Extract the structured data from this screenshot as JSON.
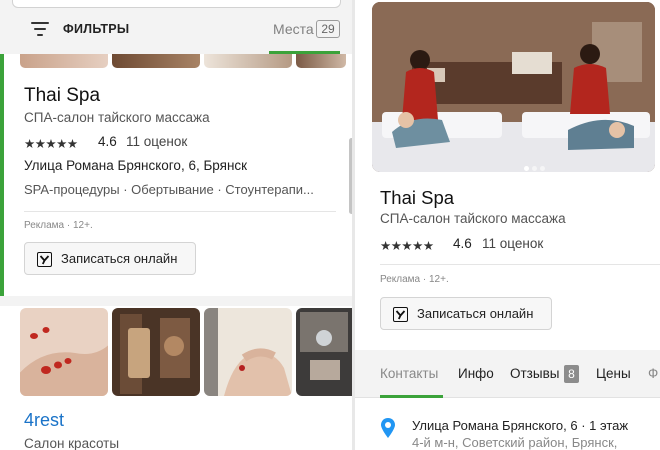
{
  "header": {
    "filters_label": "ФИЛЬТРЫ",
    "places_label": "Места",
    "places_count": "29"
  },
  "results": [
    {
      "title": "Thai Spa",
      "category": "СПА-салон тайского массажа",
      "stars": "★★★★★",
      "rating": "4.6",
      "reviews": "11 оценок",
      "address": "Улица Романа Брянского, 6, Брянск",
      "services": "SPA-процедуры · Обертывание · Стоунтерапи...",
      "ad_label": "Реклама · 12+.",
      "book_label": "Записаться онлайн"
    },
    {
      "title": "4rest",
      "category": "Салон красоты"
    }
  ],
  "detail": {
    "title": "Thai Spa",
    "category": "СПА-салон тайского массажа",
    "stars": "★★★★★",
    "rating": "4.6",
    "reviews": "11 оценок",
    "ad_label": "Реклама · 12+.",
    "book_label": "Записаться онлайн",
    "tabs": [
      {
        "label": "Контакты",
        "active": true
      },
      {
        "label": "Инфо"
      },
      {
        "label": "Отзывы",
        "badge": "8"
      },
      {
        "label": "Цены"
      },
      {
        "label": "Ф"
      }
    ],
    "address_line1": "Улица Романа Брянского, 6 · 1 этаж",
    "address_line2": "4-й м-н, Советский район, Брянск,"
  },
  "colors": {
    "accent_green": "#3ba33a",
    "link_blue": "#1a73c8",
    "pin_blue": "#2196f3"
  },
  "icons": {
    "filter": "filter-lines-icon",
    "booking": "yandex-y-icon",
    "pin": "map-pin-icon"
  }
}
